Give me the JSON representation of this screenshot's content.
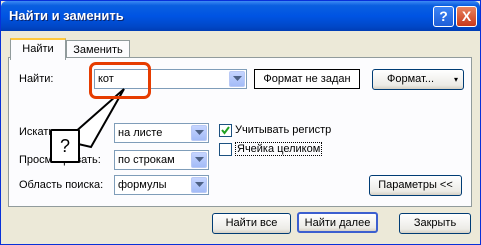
{
  "window": {
    "title": "Найти и заменить"
  },
  "titlebar": {
    "help_glyph": "?",
    "close_glyph": "X"
  },
  "tabs": [
    {
      "label": "Найти",
      "active": true
    },
    {
      "label": "Заменить",
      "active": false
    }
  ],
  "find": {
    "label": "Найти:",
    "value": "кот",
    "format_status": "Формат не задан",
    "format_button": "Формат..."
  },
  "search": {
    "label": "Искать:",
    "value": "на листе"
  },
  "lookup": {
    "label": "Просматривать:",
    "value": "по строкам"
  },
  "scope": {
    "label": "Область поиска:",
    "value": "формулы"
  },
  "options": {
    "match_case": {
      "label": "Учитывать регистр",
      "checked": true
    },
    "whole_cell": {
      "label": "Ячейка целиком",
      "checked": false
    },
    "params_button": "Параметры <<"
  },
  "callout": {
    "text": "?"
  },
  "buttons": {
    "find_all": "Найти все",
    "find_next": "Найти далее",
    "close": "Закрыть"
  }
}
